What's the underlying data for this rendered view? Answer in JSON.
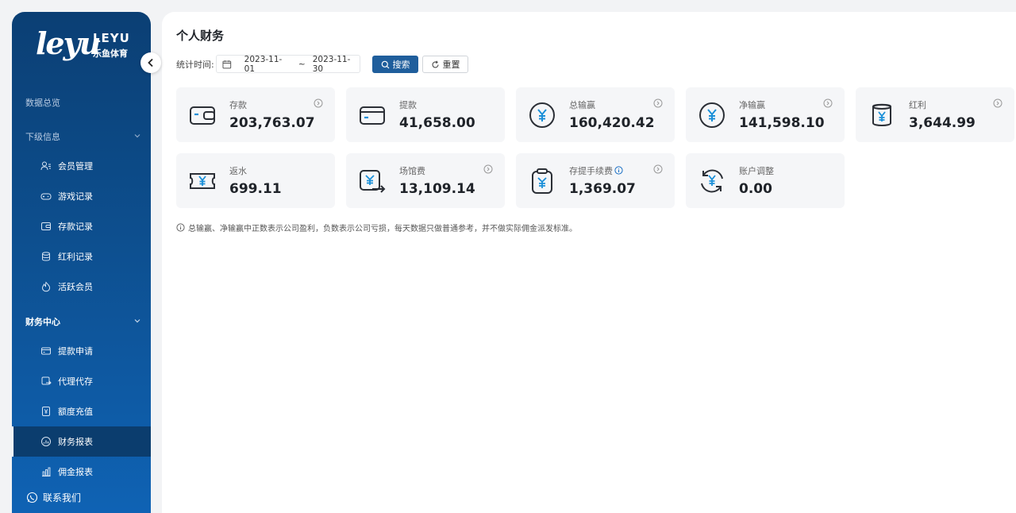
{
  "brand": {
    "logo_text": "leyu",
    "logo_en": "LEYU",
    "logo_cn": "乐鱼体育"
  },
  "sidebar": {
    "overview": "数据总览",
    "group1": {
      "label": "下级信息",
      "items": [
        {
          "label": "会员管理",
          "icon": "user-list-icon"
        },
        {
          "label": "游戏记录",
          "icon": "gamepad-icon"
        },
        {
          "label": "存款记录",
          "icon": "wallet-icon"
        },
        {
          "label": "红利记录",
          "icon": "database-icon"
        },
        {
          "label": "活跃会员",
          "icon": "flame-icon"
        }
      ]
    },
    "group2": {
      "label": "财务中心",
      "items": [
        {
          "label": "提款申请",
          "icon": "card-icon"
        },
        {
          "label": "代理代存",
          "icon": "transfer-icon"
        },
        {
          "label": "额度充值",
          "icon": "yen-doc-icon"
        },
        {
          "label": "财务报表",
          "icon": "report-icon",
          "selected": true
        },
        {
          "label": "佣金报表",
          "icon": "bar-chart-icon"
        }
      ]
    },
    "contact": "联系我们"
  },
  "main": {
    "title": "个人财务",
    "filter": {
      "label": "统计时间:",
      "start": "2023-11-01",
      "separator": "~",
      "end": "2023-11-30",
      "search": "搜索",
      "reset": "重置"
    },
    "cards": [
      {
        "label": "存款",
        "value": "203,763.07",
        "icon": "wallet-icon",
        "more": true
      },
      {
        "label": "提款",
        "value": "41,658.00",
        "icon": "card-icon",
        "more": false
      },
      {
        "label": "总输赢",
        "value": "160,420.42",
        "icon": "yen-circle-icon",
        "more": true
      },
      {
        "label": "净输赢",
        "value": "141,598.10",
        "icon": "yen-circle-icon",
        "more": true
      },
      {
        "label": "红利",
        "value": "3,644.99",
        "icon": "yen-cup-icon",
        "more": true
      },
      {
        "label": "返水",
        "value": "699.11",
        "icon": "yen-ticket-icon",
        "more": false
      },
      {
        "label": "场馆费",
        "value": "13,109.14",
        "icon": "yen-arrow-icon",
        "more": true
      },
      {
        "label": "存提手续费",
        "value": "1,369.07",
        "icon": "yen-clipboard-icon",
        "more": true,
        "info": true
      },
      {
        "label": "账户调整",
        "value": "0.00",
        "icon": "yen-refresh-icon",
        "more": false
      }
    ],
    "note": "总输赢、净输赢中正数表示公司盈利，负数表示公司亏损，每天数据只做普通参考，并不做实际佣金派发标准。"
  },
  "colors": {
    "sidebar_top": "#0b3f74",
    "sidebar_bottom": "#0f63b5",
    "primary_button": "#1f5e9c",
    "icon_accent": "#1a8fd8"
  }
}
